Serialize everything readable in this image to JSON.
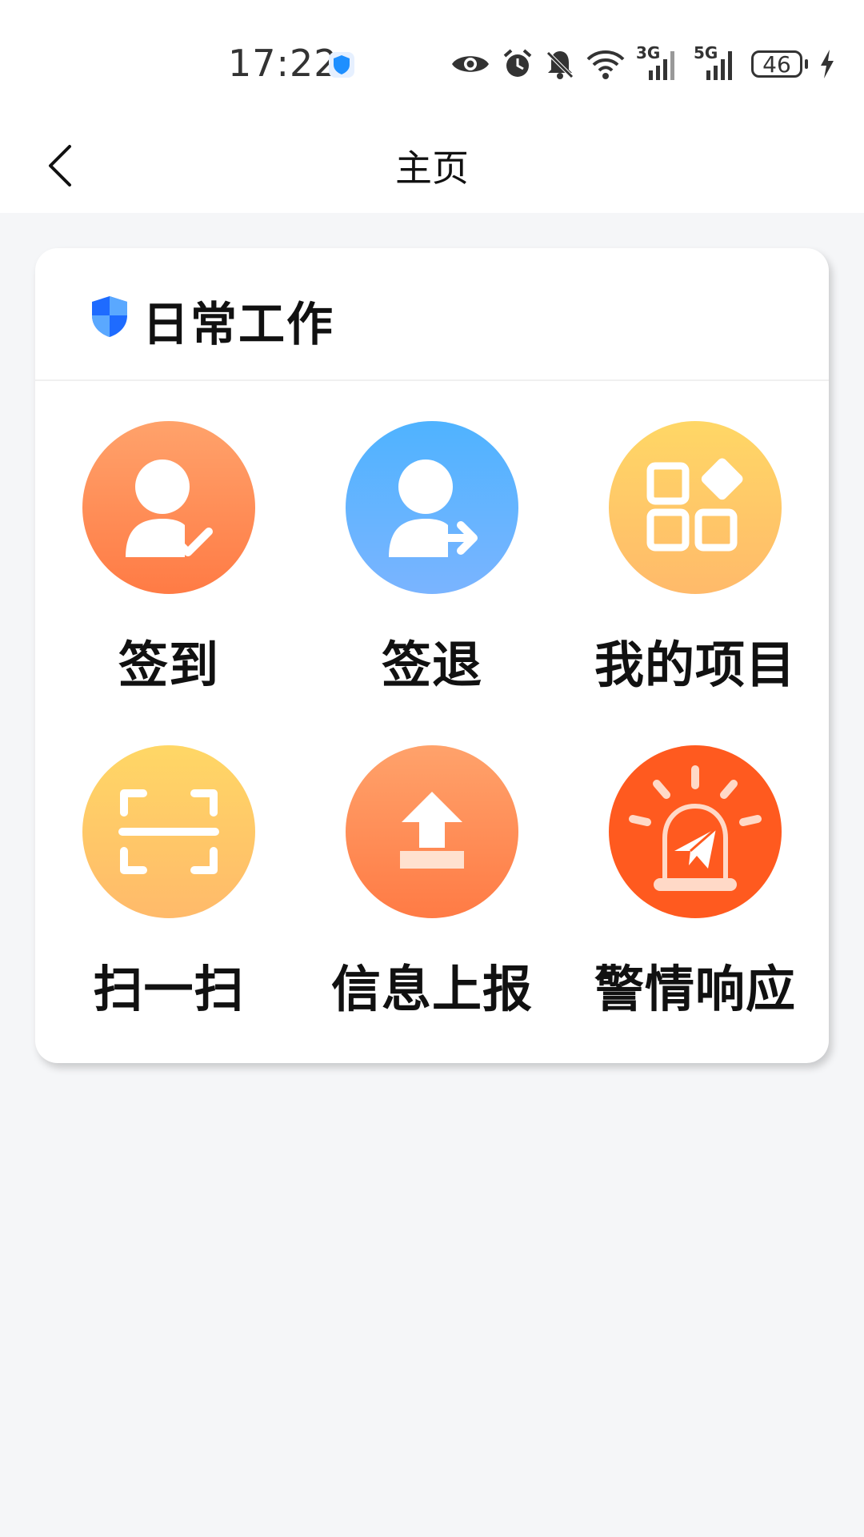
{
  "status_bar": {
    "time": "17:22",
    "net_3g": "3G",
    "net_5g": "5G",
    "battery": "46",
    "icons": [
      "shield-icon",
      "eye-icon",
      "alarm-icon",
      "bell-off-icon",
      "wifi-icon",
      "signal-3g-icon",
      "signal-5g-icon",
      "battery-icon",
      "charging-icon"
    ]
  },
  "header": {
    "title": "主页",
    "back_icon": "chevron-left-icon"
  },
  "card": {
    "title": "日常工作",
    "title_icon": "shield-icon",
    "items": [
      {
        "label": "签到",
        "icon": "user-check-icon",
        "color_top": "#ffa26b",
        "color_bottom": "#ff7b45"
      },
      {
        "label": "签退",
        "icon": "user-exit-icon",
        "color_top": "#4fb3ff",
        "color_bottom": "#7ab4ff"
      },
      {
        "label": "我的项目",
        "icon": "apps-grid-icon",
        "color_top": "#ffd766",
        "color_bottom": "#ffba6a"
      },
      {
        "label": "扫一扫",
        "icon": "scan-icon",
        "color_top": "#ffd766",
        "color_bottom": "#ffba6a"
      },
      {
        "label": "信息上报",
        "icon": "upload-icon",
        "color_top": "#ffa26b",
        "color_bottom": "#ff7b45"
      },
      {
        "label": "警情响应",
        "icon": "alarm-siren-icon",
        "color_top": "#ff5a1f",
        "color_bottom": "#ff5a1f"
      }
    ]
  },
  "colors": {
    "background": "#f5f6f8",
    "card": "#ffffff",
    "shield_blue": "#1e6bff"
  }
}
